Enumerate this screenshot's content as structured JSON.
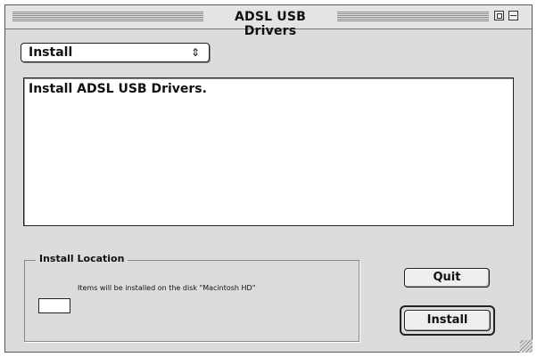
{
  "window": {
    "title": "ADSL USB Drivers"
  },
  "popup": {
    "selected": "Install",
    "arrow_glyph": "⇕"
  },
  "info": {
    "text": "Install ADSL USB Drivers."
  },
  "install_location": {
    "label": "Install Location",
    "field_value": "",
    "description": "Items will be installed on the disk \"Macintosh HD\""
  },
  "buttons": {
    "quit": "Quit",
    "install": "Install"
  },
  "colors": {
    "window_bg": "#dcdcdc",
    "content_bg": "#ffffff",
    "border": "#222222"
  }
}
